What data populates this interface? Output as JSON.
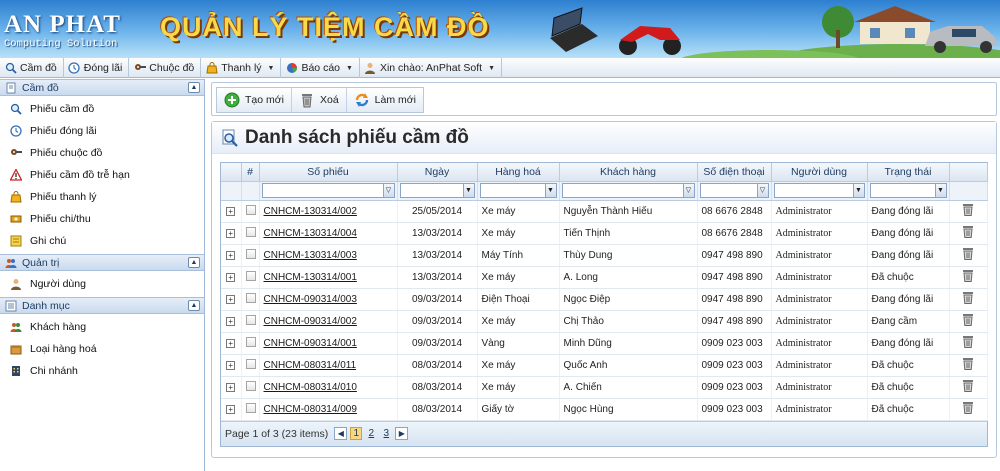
{
  "banner": {
    "brand": "AN PHAT",
    "brand_sub": "Computing Solution",
    "app_title": "QUẢN LÝ TIỆM CẦM ĐỒ"
  },
  "toolbar": {
    "items": [
      {
        "label": "Cầm đồ",
        "icon": "magnifier-icon"
      },
      {
        "label": "Đóng lãi",
        "icon": "clock-icon"
      },
      {
        "label": "Chuộc đồ",
        "icon": "key-icon"
      },
      {
        "label": "Thanh lý",
        "icon": "bag-icon",
        "dropdown": true
      },
      {
        "label": "Báo cáo",
        "icon": "chart-icon",
        "dropdown": true
      },
      {
        "label": "Xin chào: AnPhat Soft",
        "icon": "user-icon",
        "dropdown": true
      }
    ]
  },
  "sidebar": {
    "sections": [
      {
        "title": "Cầm đồ",
        "items": [
          "Phiếu cầm đồ",
          "Phiếu đóng lãi",
          "Phiếu chuộc đồ",
          "Phiếu cầm đồ trễ hạn",
          "Phiếu thanh lý",
          "Phiếu chi/thu",
          "Ghi chú"
        ]
      },
      {
        "title": "Quản trị",
        "items": [
          "Người dùng"
        ]
      },
      {
        "title": "Danh mục",
        "items": [
          "Khách hàng",
          "Loại hàng hoá",
          "Chi nhánh"
        ]
      }
    ]
  },
  "actions": {
    "create": "Tạo mới",
    "delete": "Xoá",
    "refresh": "Làm mới"
  },
  "panel": {
    "title": "Danh sách phiếu cầm đồ"
  },
  "table": {
    "columns": {
      "num": "#",
      "code": "Số phiếu",
      "date": "Ngày",
      "goods": "Hàng hoá",
      "customer": "Khách hàng",
      "phone": "Số điện thoại",
      "user": "Người dùng",
      "status": "Trạng thái"
    },
    "rows": [
      {
        "code": "CNHCM-130314/002",
        "date": "25/05/2014",
        "goods": "Xe máy",
        "customer": "Nguyễn Thành Hiếu",
        "phone": "08 6676 2848",
        "user": "Administrator",
        "status": "Đang đóng lãi"
      },
      {
        "code": "CNHCM-130314/004",
        "date": "13/03/2014",
        "goods": "Xe máy",
        "customer": "Tiến Thịnh",
        "phone": "08 6676 2848",
        "user": "Administrator",
        "status": "Đang đóng lãi"
      },
      {
        "code": "CNHCM-130314/003",
        "date": "13/03/2014",
        "goods": "Máy Tính",
        "customer": "Thùy Dung",
        "phone": "0947 498 890",
        "user": "Administrator",
        "status": "Đang đóng lãi"
      },
      {
        "code": "CNHCM-130314/001",
        "date": "13/03/2014",
        "goods": "Xe máy",
        "customer": "A. Long",
        "phone": "0947 498 890",
        "user": "Administrator",
        "status": "Đã chuộc"
      },
      {
        "code": "CNHCM-090314/003",
        "date": "09/03/2014",
        "goods": "Điện Thoại",
        "customer": "Ngọc Điệp",
        "phone": "0947 498 890",
        "user": "Administrator",
        "status": "Đang đóng lãi"
      },
      {
        "code": "CNHCM-090314/002",
        "date": "09/03/2014",
        "goods": "Xe máy",
        "customer": "Chị Thảo",
        "phone": "0947 498 890",
        "user": "Administrator",
        "status": "Đang cầm"
      },
      {
        "code": "CNHCM-090314/001",
        "date": "09/03/2014",
        "goods": "Vàng",
        "customer": "Minh Dũng",
        "phone": "0909 023 003",
        "user": "Administrator",
        "status": "Đang đóng lãi"
      },
      {
        "code": "CNHCM-080314/011",
        "date": "08/03/2014",
        "goods": "Xe máy",
        "customer": "Quốc Anh",
        "phone": "0909 023 003",
        "user": "Administrator",
        "status": "Đã chuộc"
      },
      {
        "code": "CNHCM-080314/010",
        "date": "08/03/2014",
        "goods": "Xe máy",
        "customer": "A. Chiến",
        "phone": "0909 023 003",
        "user": "Administrator",
        "status": "Đã chuộc"
      },
      {
        "code": "CNHCM-080314/009",
        "date": "08/03/2014",
        "goods": "Giấy tờ",
        "customer": "Ngọc Hùng",
        "phone": "0909 023 003",
        "user": "Administrator",
        "status": "Đã chuộc"
      }
    ]
  },
  "pager": {
    "summary": "Page 1 of 3 (23 items)",
    "pages": [
      "1",
      "2",
      "3"
    ],
    "current": "1"
  }
}
